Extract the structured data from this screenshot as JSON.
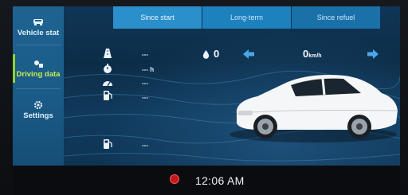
{
  "sidebar": {
    "items": [
      {
        "label": "Vehicle stat",
        "icon": "car-status-icon"
      },
      {
        "label": "Driving data",
        "icon": "driving-data-icon"
      },
      {
        "label": "Settings",
        "icon": "gear-icon"
      }
    ]
  },
  "tabs": [
    {
      "label": "Since start"
    },
    {
      "label": "Long-term"
    },
    {
      "label": "Since refuel"
    }
  ],
  "stats": [
    {
      "icon": "road-distance-icon",
      "value": "---"
    },
    {
      "icon": "clock-duration-icon",
      "value": "---",
      "unit": "h"
    },
    {
      "icon": "speed-gauge-icon",
      "value": "---"
    },
    {
      "icon": "fuel-consumption-icon",
      "value": "---"
    },
    {
      "icon": "fuel-pump-icon",
      "value": "---"
    }
  ],
  "readouts": {
    "left_value": "0",
    "speed_value": "0",
    "speed_unit": "km/h"
  },
  "status_bar": {
    "time": "12:06 AM"
  },
  "colors": {
    "accent_green": "#8fd12e",
    "tab_blue": "#1a71a8",
    "arrow_blue": "#4aa6e8"
  }
}
